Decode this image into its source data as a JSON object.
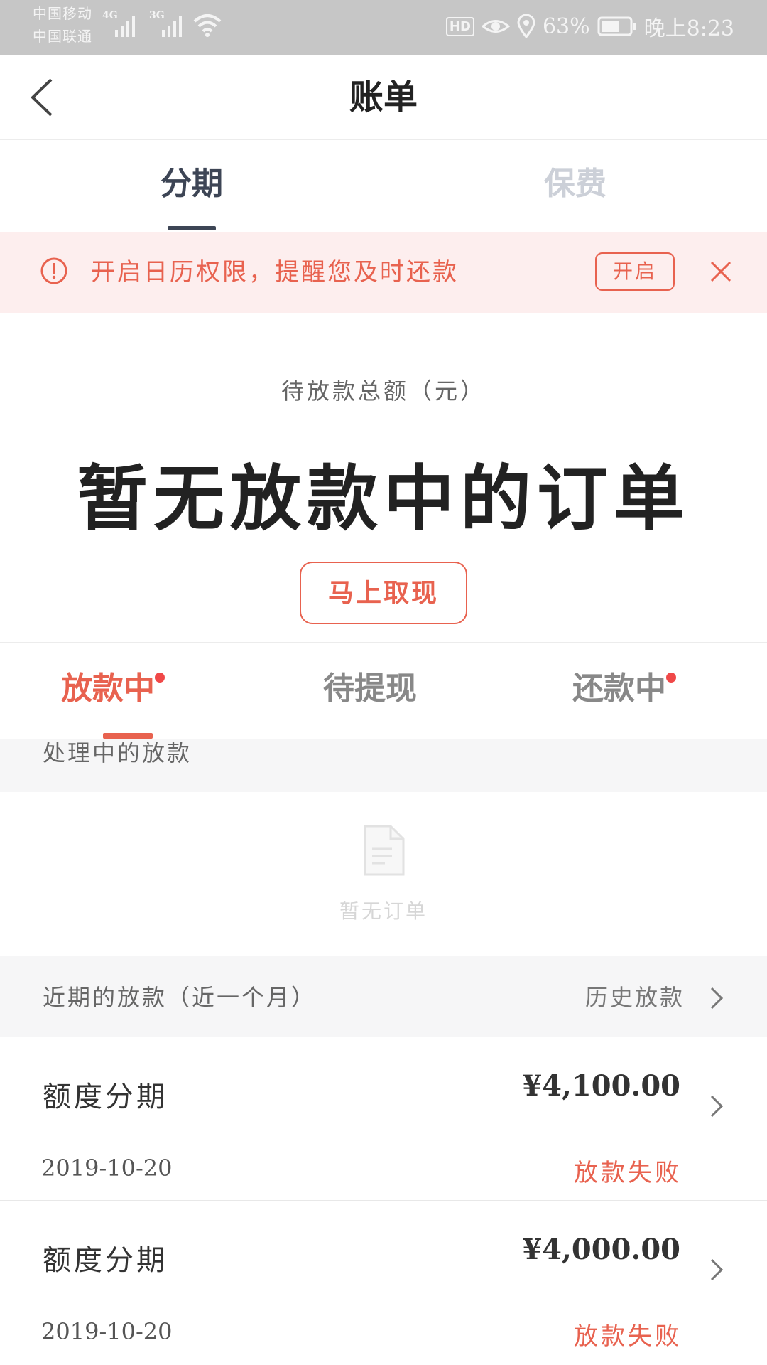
{
  "status_bar": {
    "carrier1": "中国移动",
    "carrier2": "中国联通",
    "net1": "4G",
    "net2": "3G",
    "hd": "HD",
    "battery": "63%",
    "time": "晚上8:23"
  },
  "header": {
    "title": "账单"
  },
  "top_tabs": [
    {
      "label": "分期",
      "active": true
    },
    {
      "label": "保费",
      "active": false
    }
  ],
  "banner": {
    "text": "开启日历权限，提醒您及时还款",
    "button": "开启"
  },
  "summary": {
    "label": "待放款总额（元）",
    "main": "暂无放款中的订单",
    "button": "马上取现"
  },
  "sub_tabs": [
    {
      "label": "放款中",
      "active": true,
      "dot": true
    },
    {
      "label": "待提现",
      "active": false,
      "dot": false
    },
    {
      "label": "还款中",
      "active": false,
      "dot": true
    }
  ],
  "processing": {
    "label": "处理中的放款",
    "empty_text": "暂无订单"
  },
  "recent": {
    "label": "近期的放款（近一个月）",
    "history_link": "历史放款"
  },
  "rows": [
    {
      "title": "额度分期",
      "amount": "¥4,100.00",
      "date": "2019-10-20",
      "status": "放款失败"
    },
    {
      "title": "额度分期",
      "amount": "¥4,000.00",
      "date": "2019-10-20",
      "status": "放款失败"
    }
  ],
  "colors": {
    "accent": "#e8624f",
    "tab_active": "#3d4555",
    "tab_inactive": "#ccd0d8",
    "banner_bg": "#fdeeee",
    "status_bar_bg": "#c6c6c6",
    "section_bg": "#f6f6f7"
  },
  "icons": {
    "back": "chevron-left-icon",
    "alert": "exclamation-circle-icon",
    "close": "close-icon",
    "empty": "document-icon",
    "row_arrow": "chevron-right-icon"
  }
}
